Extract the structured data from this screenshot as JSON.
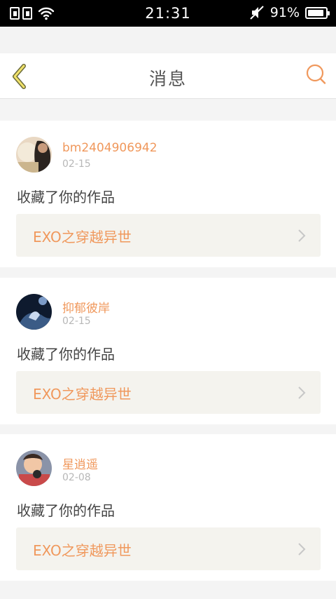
{
  "status_bar": {
    "time": "21:31",
    "battery_percent": "91%",
    "icons": [
      "sim-card-1-icon",
      "sim-card-2-icon",
      "wifi-icon",
      "mute-icon",
      "battery-icon"
    ]
  },
  "nav": {
    "title": "消息",
    "back_icon": "chevron-left-icon",
    "search_icon": "search-icon",
    "accent": "#f0985c"
  },
  "messages": [
    {
      "username": "bm2404906942",
      "date": "02-15",
      "action": "收藏了你的作品",
      "work_title": "EXO之穿越异世"
    },
    {
      "username": "抑郁彼岸",
      "date": "02-15",
      "action": "收藏了你的作品",
      "work_title": "EXO之穿越异世"
    },
    {
      "username": "星逍遥",
      "date": "02-08",
      "action": "收藏了你的作品",
      "work_title": "EXO之穿越异世"
    }
  ]
}
